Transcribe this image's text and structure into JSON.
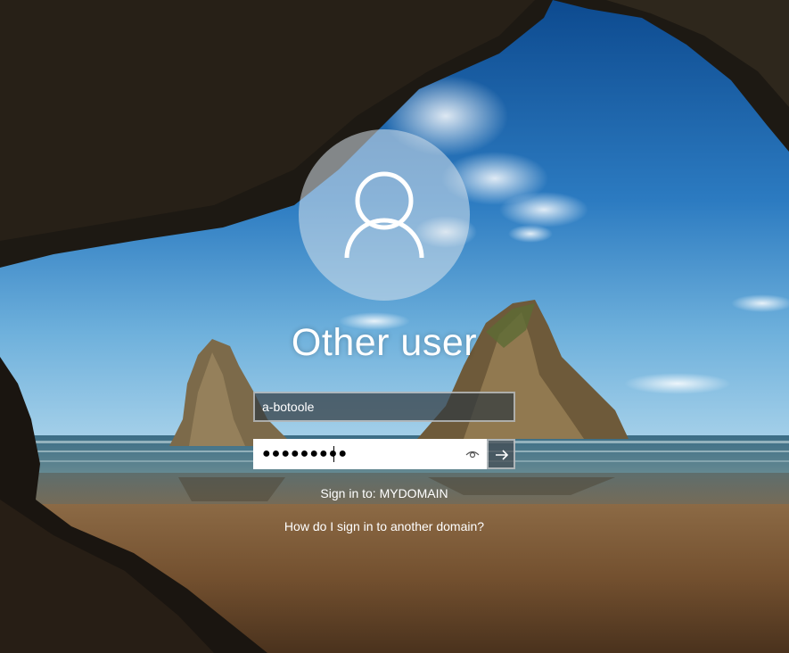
{
  "login": {
    "display_name": "Other user",
    "username_value": "a-botoole",
    "password_masked": "●●●●●●●●●",
    "sign_in_to": "Sign in to: MYDOMAIN",
    "other_domain_link": "How do I sign in to another domain?"
  },
  "icons": {
    "avatar": "user-silhouette-icon",
    "reveal": "eye-icon",
    "submit": "arrow-right-icon"
  }
}
